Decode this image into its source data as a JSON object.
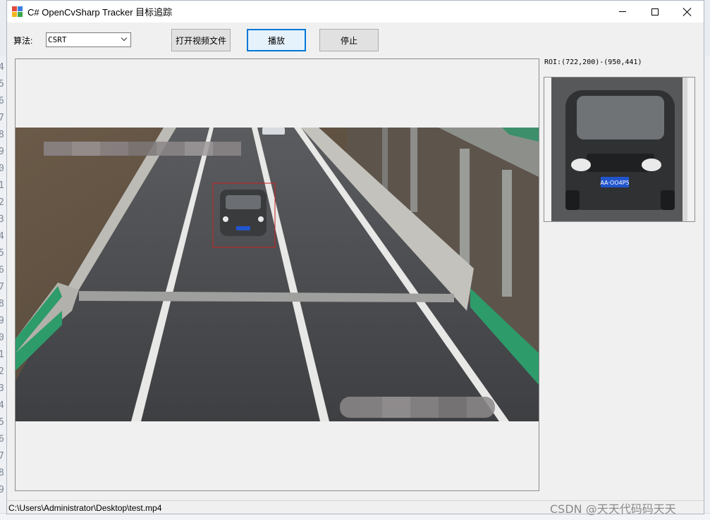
{
  "window": {
    "title": "C# OpenCvSharp Tracker 目标追踪"
  },
  "toolbar": {
    "algorithm_label": "算法:",
    "algorithm_value": "CSRT",
    "open_video_label": "打开视频文件",
    "play_label": "播放",
    "stop_label": "停止"
  },
  "roi": {
    "text": "ROI:(722,200)-(950,441)"
  },
  "preview": {
    "plate_text": "AA·OO4P5"
  },
  "status": {
    "file_path": "C:\\Users\\Administrator\\Desktop\\test.mp4"
  },
  "watermark": {
    "text": "CSDN @天天代码码天天"
  },
  "colors": {
    "accent": "#0078d7",
    "tracking_box": "#cc2222",
    "guardrail": "#2e9b6a"
  }
}
